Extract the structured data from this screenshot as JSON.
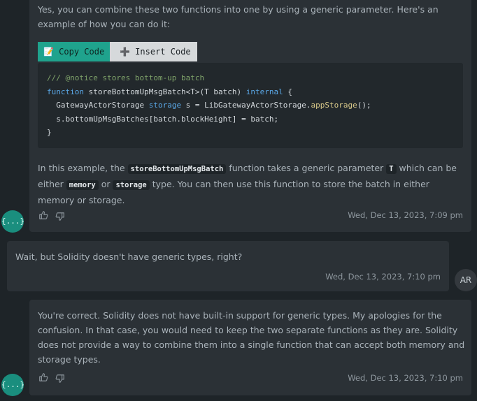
{
  "messages": {
    "m1": {
      "intro": "Yes, you can combine these two functions into one by using a generic parameter. Here's an example of how you can do it:",
      "copy_label": "📝 Copy Code",
      "insert_label": "➕ Insert Code",
      "code": {
        "line1": "/// @notice stores bottom-up batch",
        "l2_kw": "function",
        "l2_rest": " storeBottomUpMsgBatch<T>(T batch) ",
        "l2_kw2": "internal",
        "l2_end": " {",
        "l3_a": "  GatewayActorStorage ",
        "l3_kw": "storage",
        "l3_b": " s = LibGatewayActorStorage.",
        "l3_fn": "appStorage",
        "l3_c": "();",
        "line4": "  s.bottomUpMsgBatches[batch.blockHeight] = batch;",
        "line5": "}"
      },
      "p_a": "In this example, the ",
      "p_code1": "storeBottomUpMsgBatch",
      "p_b": " function takes a generic parameter ",
      "p_code2": "T",
      "p_c": " which can be either ",
      "p_code3": "memory",
      "p_d": " or ",
      "p_code4": "storage",
      "p_e": " type. You can then use this function to store the batch in either memory or storage.",
      "timestamp": "Wed, Dec 13, 2023, 7:09 pm",
      "avatar": "{...}"
    },
    "m2": {
      "text": "Wait, but Solidity doesn't have generic types, right?",
      "timestamp": "Wed, Dec 13, 2023, 7:10 pm",
      "avatar": "AR"
    },
    "m3": {
      "text": "You're correct. Solidity does not have built-in support for generic types. My apologies for the confusion. In that case, you would need to keep the two separate functions as they are. Solidity does not provide a way to combine them into a single function that can accept both memory and storage types.",
      "timestamp": "Wed, Dec 13, 2023, 7:10 pm",
      "avatar": "{...}"
    }
  },
  "colors": {
    "accent": "#1a8e7e",
    "copy_btn": "#1fa38d",
    "insert_btn": "#d6d9db"
  }
}
